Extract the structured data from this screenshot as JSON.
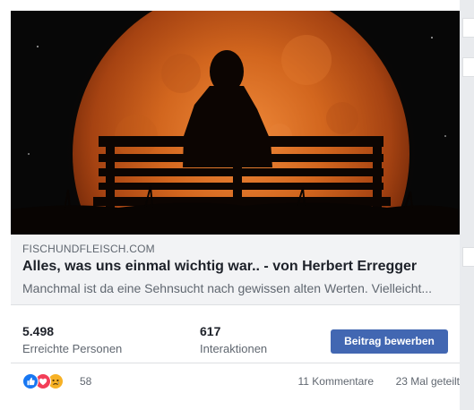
{
  "link_preview": {
    "domain": "FISCHUNDFLEISCH.COM",
    "title": "Alles, was uns einmal wichtig war.. - von Herbert Erregger",
    "description": "Manchmal ist da eine Sehnsucht nach gewissen alten Werten. Vielleicht..."
  },
  "stats": {
    "reach_value": "5.498",
    "reach_label": "Erreichte Personen",
    "engagement_value": "617",
    "engagement_label": "Interaktionen"
  },
  "boost_button_label": "Beitrag bewerben",
  "footer": {
    "reaction_icons": [
      "like-icon",
      "love-icon",
      "sad-icon"
    ],
    "reaction_count": "58",
    "comments": "11 Kommentare",
    "shares": "23 Mal geteilt"
  },
  "colors": {
    "accent": "#4267b2",
    "link_box_bg": "#f2f3f5",
    "text_primary": "#1d2129",
    "text_secondary": "#606770",
    "like_blue": "#1877f2",
    "love_red": "#f33e58",
    "sad_yellow": "#f7b125",
    "moon_orange": "#d2661e"
  }
}
